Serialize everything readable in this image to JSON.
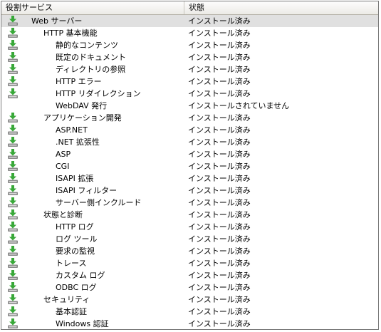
{
  "header": {
    "col_role": "役割サービス",
    "col_status": "状態"
  },
  "colors": {
    "selected_row": "#e0e0e0",
    "icon_arrow": "#38a838",
    "icon_tray": "#8a8a8a"
  },
  "rows": [
    {
      "label": "Web サーバー",
      "status": "インストール済み",
      "level": 0,
      "icon": "installed-icon",
      "selected": true
    },
    {
      "label": "HTTP 基本機能",
      "status": "インストール済み",
      "level": 1,
      "icon": "installed-icon"
    },
    {
      "label": "静的なコンテンツ",
      "status": "インストール済み",
      "level": 2,
      "icon": "installed-icon"
    },
    {
      "label": "既定のドキュメント",
      "status": "インストール済み",
      "level": 2,
      "icon": "installed-icon"
    },
    {
      "label": "ディレクトリの参照",
      "status": "インストール済み",
      "level": 2,
      "icon": "installed-icon"
    },
    {
      "label": "HTTP エラー",
      "status": "インストール済み",
      "level": 2,
      "icon": "installed-icon"
    },
    {
      "label": "HTTP リダイレクション",
      "status": "インストール済み",
      "level": 2,
      "icon": "installed-icon"
    },
    {
      "label": "WebDAV 発行",
      "status": "インストールされていません",
      "level": 2,
      "icon": "none"
    },
    {
      "label": "アプリケーション開発",
      "status": "インストール済み",
      "level": 1,
      "icon": "installed-icon"
    },
    {
      "label": "ASP.NET",
      "status": "インストール済み",
      "level": 2,
      "icon": "installed-icon"
    },
    {
      "label": ".NET 拡張性",
      "status": "インストール済み",
      "level": 2,
      "icon": "installed-icon"
    },
    {
      "label": "ASP",
      "status": "インストール済み",
      "level": 2,
      "icon": "installed-icon"
    },
    {
      "label": "CGI",
      "status": "インストール済み",
      "level": 2,
      "icon": "installed-icon"
    },
    {
      "label": "ISAPI 拡張",
      "status": "インストール済み",
      "level": 2,
      "icon": "installed-icon"
    },
    {
      "label": "ISAPI フィルター",
      "status": "インストール済み",
      "level": 2,
      "icon": "installed-icon"
    },
    {
      "label": "サーバー側インクルード",
      "status": "インストール済み",
      "level": 2,
      "icon": "installed-icon"
    },
    {
      "label": "状態と診断",
      "status": "インストール済み",
      "level": 1,
      "icon": "installed-icon"
    },
    {
      "label": "HTTP ログ",
      "status": "インストール済み",
      "level": 2,
      "icon": "installed-icon"
    },
    {
      "label": "ログ ツール",
      "status": "インストール済み",
      "level": 2,
      "icon": "installed-icon"
    },
    {
      "label": "要求の監視",
      "status": "インストール済み",
      "level": 2,
      "icon": "installed-icon"
    },
    {
      "label": "トレース",
      "status": "インストール済み",
      "level": 2,
      "icon": "installed-icon"
    },
    {
      "label": "カスタム ログ",
      "status": "インストール済み",
      "level": 2,
      "icon": "installed-icon"
    },
    {
      "label": "ODBC ログ",
      "status": "インストール済み",
      "level": 2,
      "icon": "installed-icon"
    },
    {
      "label": "セキュリティ",
      "status": "インストール済み",
      "level": 1,
      "icon": "installed-icon"
    },
    {
      "label": "基本認証",
      "status": "インストール済み",
      "level": 2,
      "icon": "installed-icon"
    },
    {
      "label": "Windows 認証",
      "status": "インストール済み",
      "level": 2,
      "icon": "installed-icon"
    }
  ]
}
